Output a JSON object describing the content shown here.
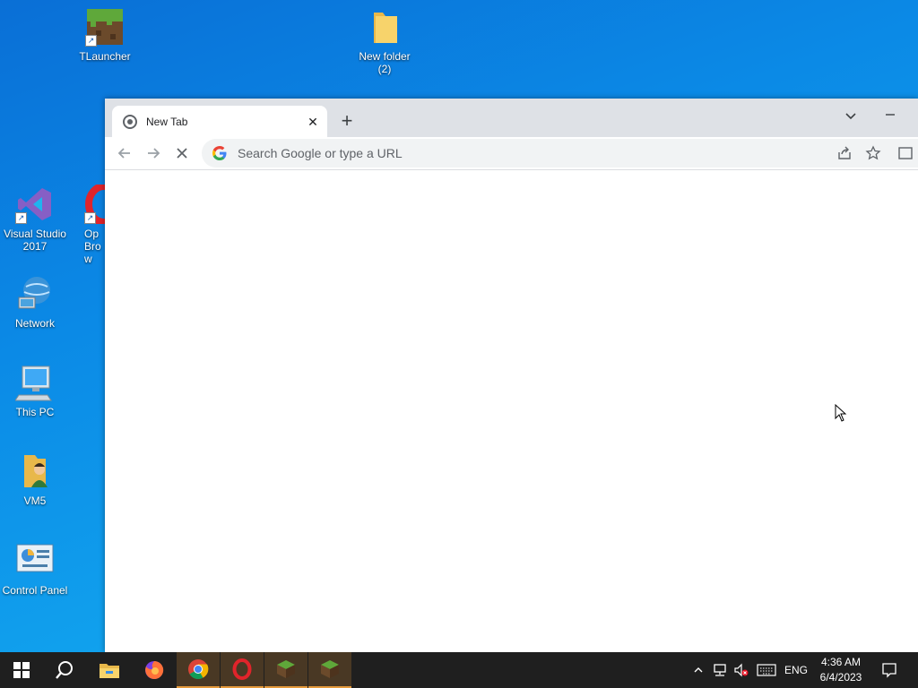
{
  "desktop": {
    "icons": [
      {
        "label": "TLauncher"
      },
      {
        "label": "New folder\n(2)"
      },
      {
        "label": "Visual Studio 2017"
      },
      {
        "label": "Op Brow"
      },
      {
        "label": "Network"
      },
      {
        "label": "This PC"
      },
      {
        "label": "VM5"
      },
      {
        "label": "Control Panel"
      }
    ]
  },
  "browser": {
    "tab_title": "New Tab",
    "omnibox_placeholder": "Search Google or type a URL"
  },
  "taskbar": {
    "language": "ENG",
    "time": "4:36 AM",
    "date": "6/4/2023"
  },
  "colors": {
    "desktop_bg": "#0b8ae6",
    "taskbar_bg": "#1f1f1f",
    "tabstrip_bg": "#dee1e6",
    "active_taskbar_accent": "#e59a3b"
  }
}
